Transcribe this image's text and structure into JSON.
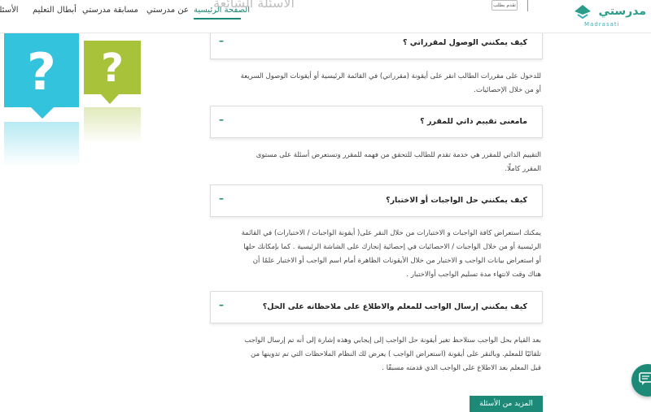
{
  "header": {
    "nav": [
      {
        "label": "الأسئلة"
      },
      {
        "label": "أبطال التعليم"
      },
      {
        "label": "مسابقة مدرستي"
      },
      {
        "label": "عن مدرستي"
      },
      {
        "label": "الصفحة الرئيسية"
      }
    ],
    "faded_heading": "الأسئلة الشائعة",
    "skip_label": "تقدم بطلب",
    "logo_ar": "مدرستي",
    "logo_en": "Madrasati"
  },
  "faq": [
    {
      "question": "كيف يمكنني الوصول لمقرراتي ؟",
      "toggle": "–",
      "answer": [
        "للدخول على مقررات الطالب انقر على أيقونة (مقرراتي) في القائمة الرئيسية أو أيقونات الوصول السريعة",
        "أو من خلال الإحصائيات."
      ]
    },
    {
      "question": "مامعنى تقييم ذاتي للمقرر ؟",
      "toggle": "–",
      "answer": [
        "التقييم الذاتي للمقرر هي خدمة تقدم للطالب للتحقق من فهمه للمقرر وتستعرض أسئلة على مستوى",
        "المقرر كاملًا."
      ]
    },
    {
      "question": "كيف يمكنني حل الواجبات أو الاختبار؟",
      "toggle": "–",
      "answer": [
        "يمكنك استعراض كافة الواجبات و الاختبارات من خلال النقر على( أيقونة الواجبات / الاختبارات) في القائمة",
        "الرئيسية أو من خلال الواجبات / الاحصائيات في إحصائية إنجازك على الشاشة الرئيسية . كما بإمكانك حلها",
        "أو استعراض بيانات الواجب و الاختبار من خلال الأيقونات الظاهرة أمام اسم الواجب أو الاختبار علمًا أن",
        "هناك وقت لانتهاء مدة تسليم الواجب أوالاختبار ."
      ]
    },
    {
      "question": "كيف يمكنني إرسال الواجب للمعلم والاطلاع على ملاحظاته على الحل؟",
      "toggle": "–",
      "answer": [
        "بعد القيام بحل الواجب ستلاحظ تغير أيقونة حل الواجب إلى إيجابي وهذه إشارة إلى أنه تم إرسال الواجب",
        "تلقائيًا للمعلم. وبالنقر على أيقونة (استعراض الواجب ) يعرض لك النظام الملاحظات التي تم تدوينها من",
        "قبل المعلم بعد الاطلاع على الواجب الذي قدمته مسبقًا ."
      ]
    }
  ],
  "more_button": "المزيد من الأسئلة",
  "colors": {
    "brand": "#1d8a78",
    "deco_blue": "#33c3dc",
    "deco_green": "#a8c23a"
  }
}
